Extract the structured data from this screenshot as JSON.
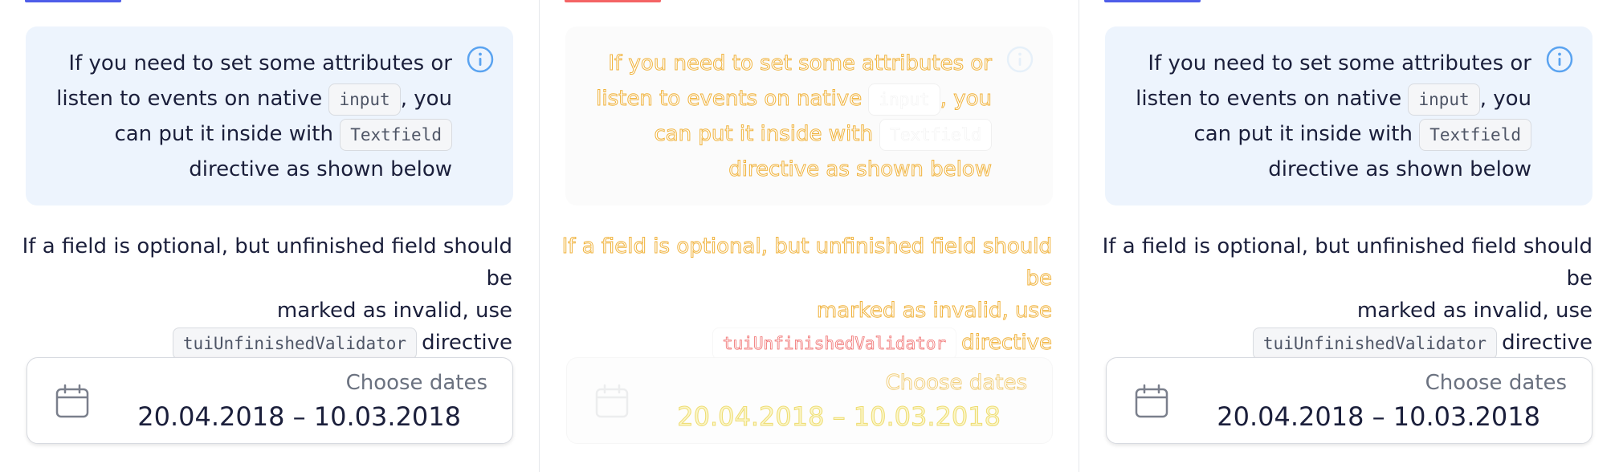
{
  "colors": {
    "tab_active_blue": "#4e5de9",
    "tab_active_red": "#f46465",
    "info_blue": "#5aa3f0",
    "notice_bg": "#edf4fd"
  },
  "panels": [
    {
      "notice": {
        "line1": "If you need to set some attributes or",
        "line2_before": "listen to events on native",
        "code1": "input",
        "line2_after": ", you",
        "line3_before": "can put it inside with",
        "code2": "Textfield",
        "line4": "directive as shown below",
        "icon": "info-icon"
      },
      "paragraph": {
        "line1": "If a field is optional, but unfinished field should be",
        "line2": "marked as invalid, use",
        "code": "tuiUnfinishedValidator",
        "line3_after": "directive"
      },
      "date_range": {
        "label": "Choose dates",
        "value": "20.04.2018 – 10.03.2018",
        "icon": "calendar-icon"
      }
    },
    {
      "notice": {
        "line1": "If you need to set some attributes or",
        "line2_before": "listen to events on native",
        "code1": "input",
        "line2_after": ", you",
        "line3_before": "can put it inside with",
        "code2": "Textfield",
        "line4": "directive as shown below",
        "icon": "info-icon"
      },
      "paragraph": {
        "line1": "If a field is optional, but unfinished field should be",
        "line2": "marked as invalid, use",
        "code": "tuiUnfinishedValidator",
        "line3_after": "directive"
      },
      "date_range": {
        "label": "Choose dates",
        "value": "20.04.2018 – 10.03.2018",
        "icon": "calendar-icon"
      }
    },
    {
      "notice": {
        "line1": "If you need to set some attributes or",
        "line2_before": "listen to events on native",
        "code1": "input",
        "line2_after": ", you",
        "line3_before": "can put it inside with",
        "code2": "Textfield",
        "line4": "directive as shown below",
        "icon": "info-icon"
      },
      "paragraph": {
        "line1": "If a field is optional, but unfinished field should be",
        "line2": "marked as invalid, use",
        "code": "tuiUnfinishedValidator",
        "line3_after": "directive"
      },
      "date_range": {
        "label": "Choose dates",
        "value": "20.04.2018 – 10.03.2018",
        "icon": "calendar-icon"
      }
    }
  ]
}
